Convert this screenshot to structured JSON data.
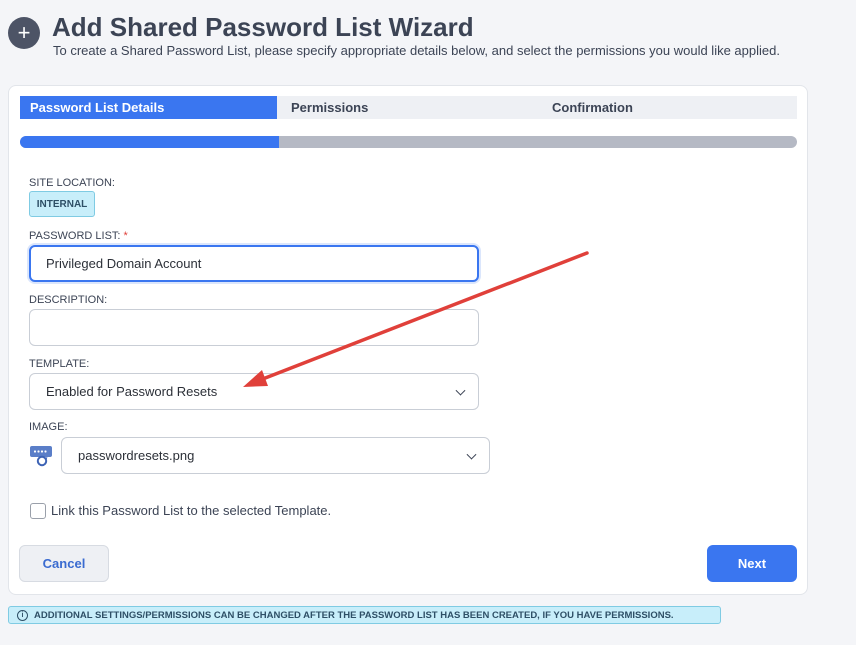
{
  "header": {
    "title": "Add Shared Password List Wizard",
    "subtitle": "To create a Shared Password List, please specify appropriate details below, and select the permissions you would like applied.",
    "icon": "plus-icon"
  },
  "tabs": [
    {
      "label": "Password List Details",
      "active": true
    },
    {
      "label": "Permissions",
      "active": false
    },
    {
      "label": "Confirmation",
      "active": false
    }
  ],
  "progress": {
    "step": 1,
    "total": 3
  },
  "form": {
    "site_location_label": "SITE LOCATION:",
    "site_location_value": "INTERNAL",
    "password_list_label": "PASSWORD LIST:",
    "required_marker": "*",
    "password_list_value": "Privileged Domain Account",
    "description_label": "DESCRIPTION:",
    "description_value": "",
    "template_label": "TEMPLATE:",
    "template_value": "Enabled for Password Resets",
    "image_label": "IMAGE:",
    "image_value": "passwordresets.png",
    "link_checkbox_label": "Link this Password List to the selected Template.",
    "link_checked": false
  },
  "buttons": {
    "cancel": "Cancel",
    "next": "Next"
  },
  "info_bar": {
    "icon": "info-icon",
    "text": "ADDITIONAL SETTINGS/PERMISSIONS CAN BE CHANGED AFTER THE PASSWORD LIST HAS BEEN CREATED, IF YOU HAVE PERMISSIONS."
  },
  "colors": {
    "accent": "#3a76f0",
    "annotation_arrow": "#e0403a",
    "badge_bg": "#c8eefa"
  }
}
